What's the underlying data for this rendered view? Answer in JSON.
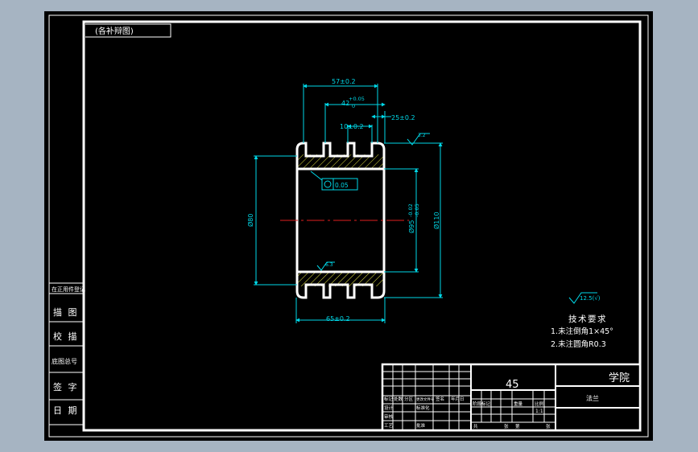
{
  "sheet": {
    "view_label": "(各补辩图)",
    "left_strip": {
      "record_header": "在正用件登记",
      "row_labels": [
        "描 图",
        "校 描",
        "底图总号",
        "签 字",
        "日 期"
      ]
    }
  },
  "drawing": {
    "dims": {
      "overall_top": "57±0.2",
      "groove_a": "42",
      "groove_a_tol_upper": "+0.05",
      "groove_a_tol_lower": "0",
      "step": "25±0.2",
      "groove_width": "10±0.2",
      "bottom_width": "65±0.2",
      "left_dia": "Ø80",
      "inner_dia": "Ø95",
      "inner_tol_upper": "-0.02",
      "inner_tol_lower": "-0.05",
      "outer_dia": "Ø110",
      "runout": "0.05",
      "surface_top": "3.2",
      "surface_mid": "6.3",
      "surface_default": "12.5(√)"
    },
    "tech_req": {
      "title": "技术要求",
      "items": [
        "1.未注倒角1×45°",
        "2.未注圆角R0.3"
      ]
    }
  },
  "title_block": {
    "material": "45",
    "school": "学院",
    "part_name": "法兰",
    "scale_value": "1:1",
    "mini_headers": [
      "标记",
      "处数",
      "分区",
      "更改文件号",
      "签名",
      "年月日"
    ],
    "role_labels": [
      "设计",
      "标准化",
      "审核",
      "工艺",
      "批准"
    ],
    "stage_headers": [
      "阶段标记",
      "重量",
      "比例"
    ],
    "sheet_labels": [
      "共",
      "张",
      "第",
      "张"
    ]
  },
  "colors": {
    "line": "#ffffff",
    "dim": "#00d8e8",
    "hatch": "#e6e645",
    "center": "#e02020",
    "paper": "#000000",
    "frame_bg": "#a6b4c2"
  }
}
